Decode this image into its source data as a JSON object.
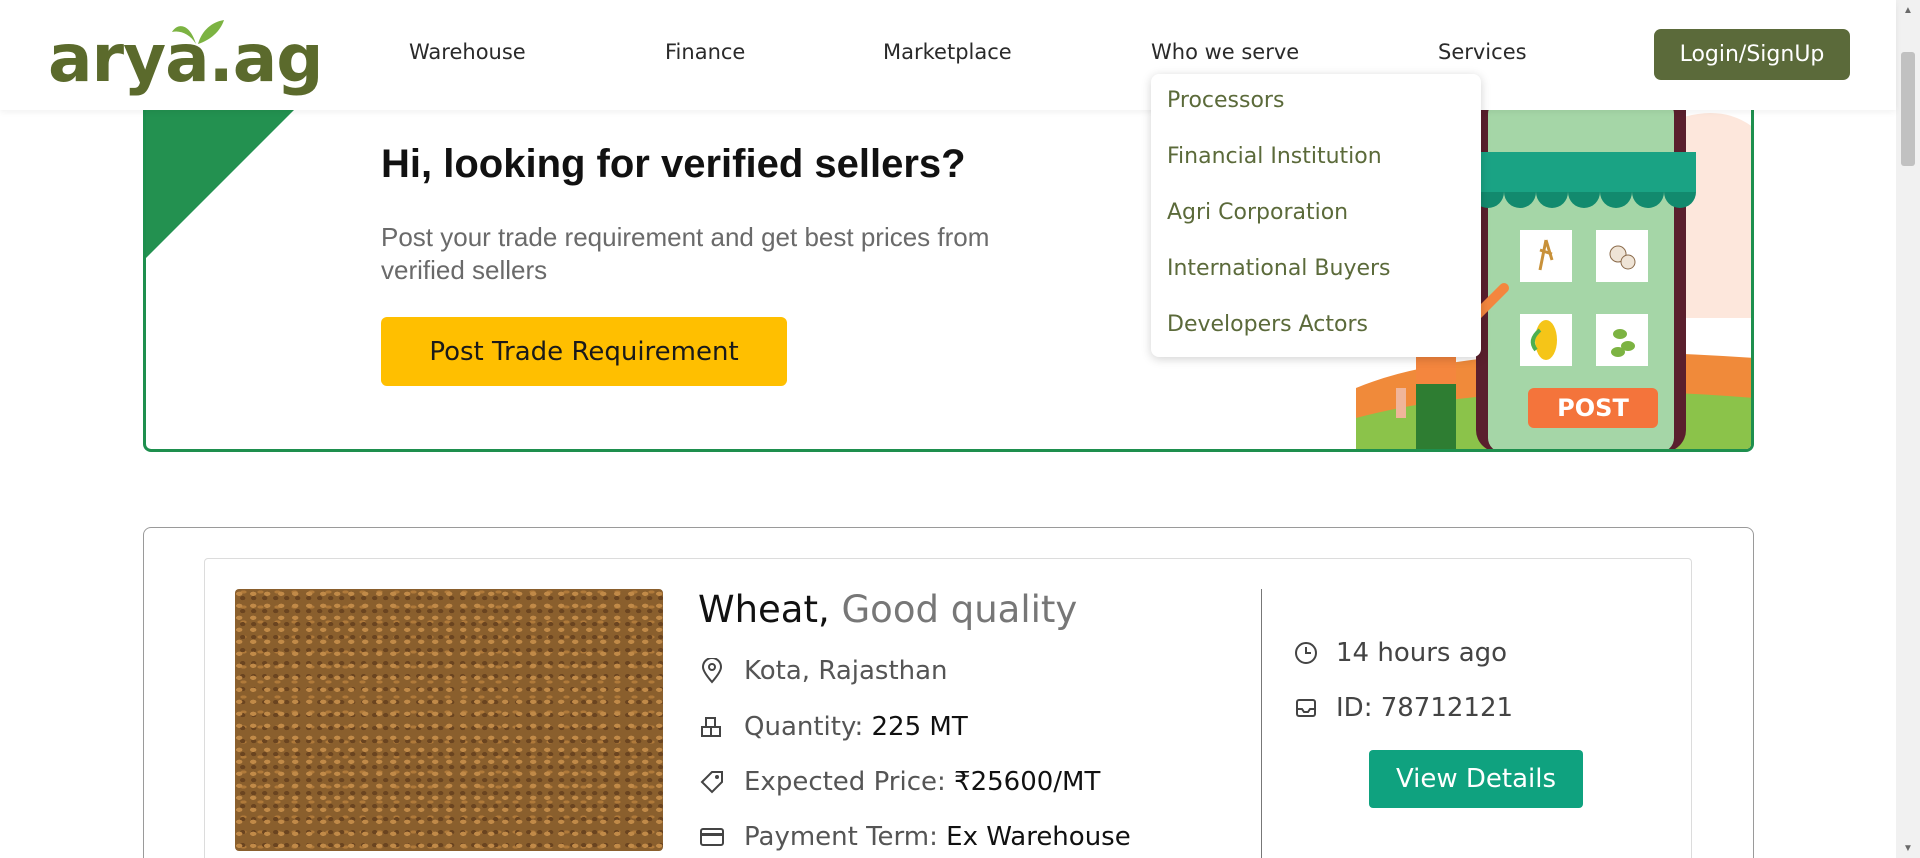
{
  "header": {
    "logo_text": "arya.ag",
    "nav": [
      "Warehouse",
      "Finance",
      "Marketplace",
      "Who we serve",
      "Services"
    ],
    "login_label": "Login/SignUp"
  },
  "dropdown": {
    "items": [
      "Processors",
      "Financial Institution",
      "Agri Corporation",
      "International Buyers",
      "Developers Actors"
    ]
  },
  "banner": {
    "title": "Hi, looking for verified sellers?",
    "subtitle": "Post your trade requirement and get best prices from verified sellers",
    "cta_label": "Post Trade Requirement",
    "phone_label": "POST"
  },
  "listing": {
    "commodity": "Wheat,",
    "quality": "Good quality",
    "location": "Kota, Rajasthan",
    "quantity_label": "Quantity:",
    "quantity_value": "225 MT",
    "price_label": "Expected Price:",
    "price_value": "₹25600/MT",
    "payment_label": "Payment Term:",
    "payment_value": "Ex Warehouse",
    "posted": "14 hours ago",
    "id": "ID: 78712121",
    "view_label": "View Details"
  },
  "colors": {
    "brand_olive": "#5b6a3a",
    "banner_green": "#239150",
    "cta_yellow": "#ffbf00",
    "view_teal": "#0fa27f"
  }
}
